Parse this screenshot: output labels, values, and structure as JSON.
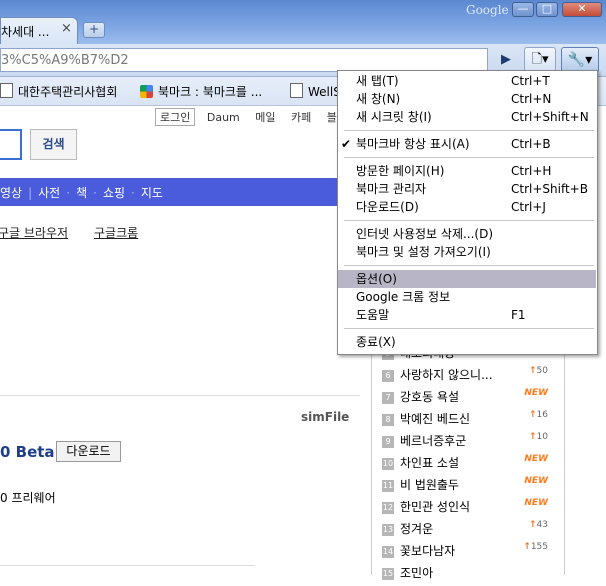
{
  "browser": {
    "tab_title": "차세대 ...",
    "tab_close": "×",
    "new_tab": "+",
    "brand": "Google",
    "win_min": "—",
    "win_max": "□",
    "win_close": "✕",
    "url": "3%C5%A9%B7%D2",
    "go_icon": "▶",
    "page_menu_icon": "🗋▾",
    "wrench_icon": "🔧▾"
  },
  "bookmarks": [
    {
      "label": "대한주택관리사협회",
      "icon": "page-icon"
    },
    {
      "label": "북마크 : 북마크를 ...",
      "icon": "google-icon"
    },
    {
      "label": "WellS",
      "icon": "page-icon"
    }
  ],
  "page": {
    "login": "로그인",
    "top_links": [
      "Daum",
      "메일",
      "카페",
      "블"
    ],
    "search_button": "검색",
    "nav_items": [
      "영상",
      "사전",
      "책",
      "쇼핑",
      "지도"
    ],
    "links": [
      "구글 브라우저",
      "구글크롬"
    ],
    "simfile_logo": "simFile",
    "version": "0 Beta",
    "download_button": "다운로드",
    "license": "0  프리웨어"
  },
  "ranking": [
    {
      "num": "5",
      "text": "대조의대왕",
      "badge": "NEW",
      "type": "new"
    },
    {
      "num": "6",
      "text": "사랑하지 않으니...",
      "badge": "50",
      "type": "up"
    },
    {
      "num": "7",
      "text": "강호동 욕설",
      "badge": "NEW",
      "type": "new"
    },
    {
      "num": "8",
      "text": "박예진 베드신",
      "badge": "16",
      "type": "up"
    },
    {
      "num": "9",
      "text": "베르너증후군",
      "badge": "10",
      "type": "up"
    },
    {
      "num": "10",
      "text": "차인표 소설",
      "badge": "NEW",
      "type": "new"
    },
    {
      "num": "11",
      "text": "비 법원출두",
      "badge": "NEW",
      "type": "new"
    },
    {
      "num": "12",
      "text": "한민관 성인식",
      "badge": "NEW",
      "type": "new"
    },
    {
      "num": "13",
      "text": "정겨운",
      "badge": "43",
      "type": "up"
    },
    {
      "num": "14",
      "text": "꽃보다남자",
      "badge": "155",
      "type": "up"
    },
    {
      "num": "15",
      "text": "조민아",
      "badge": "",
      "type": "none"
    }
  ],
  "menu": {
    "groups": [
      [
        {
          "label": "새 탭(T)",
          "shortcut": "Ctrl+T"
        },
        {
          "label": "새 창(N)",
          "shortcut": "Ctrl+N"
        },
        {
          "label": "새 시크릿 창(I)",
          "shortcut": "Ctrl+Shift+N"
        }
      ],
      [
        {
          "label": "북마크바 항상 표시(A)",
          "shortcut": "Ctrl+B",
          "checked": true
        }
      ],
      [
        {
          "label": "방문한 페이지(H)",
          "shortcut": "Ctrl+H"
        },
        {
          "label": "북마크 관리자",
          "shortcut": "Ctrl+Shift+B"
        },
        {
          "label": "다운로드(D)",
          "shortcut": "Ctrl+J"
        }
      ],
      [
        {
          "label": "인터넷 사용정보 삭제...(D)",
          "shortcut": ""
        },
        {
          "label": "북마크 및 설정 가져오기(I)",
          "shortcut": ""
        }
      ],
      [
        {
          "label": "옵션(O)",
          "shortcut": "",
          "highlighted": true
        },
        {
          "label": "Google 크롬 정보",
          "shortcut": ""
        },
        {
          "label": "도움말",
          "shortcut": "F1"
        }
      ],
      [
        {
          "label": "종료(X)",
          "shortcut": ""
        }
      ]
    ],
    "check_mark": "✔"
  },
  "colors": {
    "nav_bar": "#4a5cdc",
    "menu_highlight": "#b8b6c6",
    "new_badge": "#ff7a1a"
  }
}
